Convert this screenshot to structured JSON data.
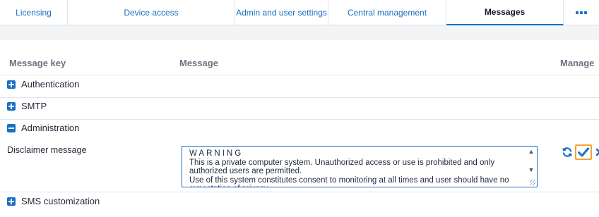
{
  "tabs": [
    {
      "label": "Licensing"
    },
    {
      "label": "Device access"
    },
    {
      "label": "Admin and user settings"
    },
    {
      "label": "Central management"
    },
    {
      "label": "Messages",
      "active": true
    }
  ],
  "more_icon": "more-dots-icon",
  "table": {
    "headers": {
      "key": "Message key",
      "message": "Message",
      "manage": "Manage"
    },
    "groups": [
      {
        "label": "Authentication",
        "state": "collapsed"
      },
      {
        "label": "SMTP",
        "state": "collapsed"
      },
      {
        "label": "Administration",
        "state": "expanded"
      },
      {
        "label": "SMS customization",
        "state": "collapsed"
      }
    ],
    "disclaimer": {
      "label": "Disclaimer message",
      "heading": "WARNING",
      "body": "This is a private computer system. Unauthorized access or use is prohibited and only authorized users are permitted.\nUse of this system constitutes consent to monitoring at all times and user should have no expectation of privacy."
    }
  },
  "colors": {
    "accent": "#1a6fc0",
    "focus_outline": "#f2a33a"
  },
  "actions": {
    "reset_icon": "reset-icon",
    "save_icon": "checkmark-icon",
    "cancel_icon": "close-icon"
  }
}
